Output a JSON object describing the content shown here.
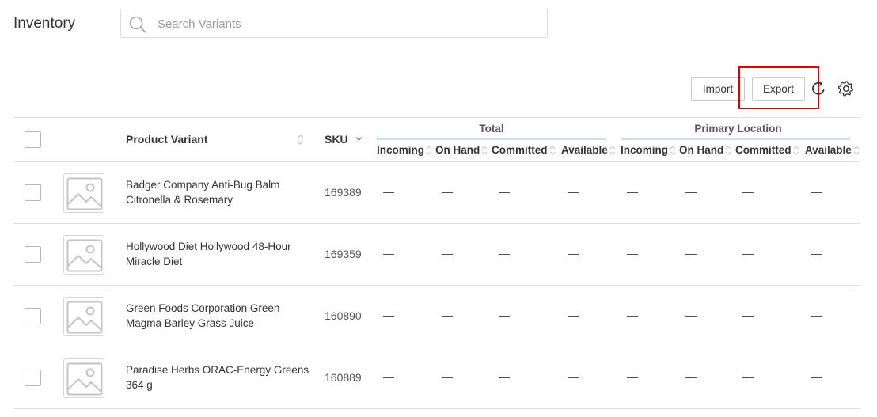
{
  "header": {
    "title": "Inventory",
    "search_placeholder": "Search Variants"
  },
  "toolbar": {
    "import_label": "Import",
    "export_label": "Export"
  },
  "table": {
    "columns": {
      "product": "Product Variant",
      "sku": "SKU"
    },
    "groups": [
      {
        "label": "Total",
        "sub": [
          "Incoming",
          "On Hand",
          "Committed",
          "Available"
        ]
      },
      {
        "label": "Primary Location",
        "sub": [
          "Incoming",
          "On Hand",
          "Committed",
          "Available"
        ]
      }
    ],
    "rows": [
      {
        "name_line1": "Badger Company Anti-Bug Balm",
        "name_line2": "Citronella & Rosemary",
        "sku": "169389",
        "values": [
          "—",
          "—",
          "—",
          "—",
          "—",
          "—",
          "—",
          "—"
        ]
      },
      {
        "name_line1": "Hollywood Diet Hollywood 48-Hour",
        "name_line2": "Miracle Diet",
        "sku": "169359",
        "values": [
          "—",
          "—",
          "—",
          "—",
          "—",
          "—",
          "—",
          "—"
        ]
      },
      {
        "name_line1": "Green Foods Corporation Green",
        "name_line2": "Magma Barley Grass Juice",
        "sku": "160890",
        "values": [
          "—",
          "—",
          "—",
          "—",
          "—",
          "—",
          "—",
          "—"
        ]
      },
      {
        "name_line1": "Paradise Herbs ORAC-Energy Greens",
        "name_line2": "364 g",
        "sku": "160889",
        "values": [
          "—",
          "—",
          "—",
          "—",
          "—",
          "—",
          "—",
          "—"
        ]
      }
    ]
  },
  "colors": {
    "highlight": "#e00000",
    "group_line": "#cfe0ec",
    "border": "#dedede"
  }
}
